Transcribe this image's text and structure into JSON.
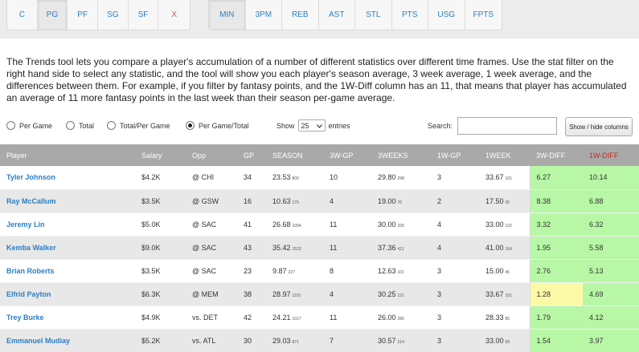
{
  "position_filters": [
    {
      "label": "C",
      "active": false
    },
    {
      "label": "PG",
      "active": true
    },
    {
      "label": "PF",
      "active": false
    },
    {
      "label": "SG",
      "active": false
    },
    {
      "label": "SF",
      "active": false
    },
    {
      "label": "X",
      "active": false
    }
  ],
  "stat_filters": [
    {
      "label": "MIN",
      "active": true
    },
    {
      "label": "3PM",
      "active": false
    },
    {
      "label": "REB",
      "active": false
    },
    {
      "label": "AST",
      "active": false
    },
    {
      "label": "STL",
      "active": false
    },
    {
      "label": "PTS",
      "active": false
    },
    {
      "label": "USG",
      "active": false
    },
    {
      "label": "FPTS",
      "active": false
    }
  ],
  "description": "The Trends tool lets you compare a player's accumulation of a number of different statistics over different time frames. Use the stat filter on the right hand side to select any statistic, and the tool will show you each player's season average, 3 week average, 1 week average, and the differences between them. For example, if you filter by fantasy points, and the 1W-Diff column has an 11, that means that player has accumulated an average of 11 more fantasy points in the last week than their season per-game average.",
  "view_options": [
    {
      "label": "Per Game",
      "checked": false
    },
    {
      "label": "Total",
      "checked": false
    },
    {
      "label": "Total/Per Game",
      "checked": false
    },
    {
      "label": "Per Game/Total",
      "checked": true
    }
  ],
  "length": {
    "show_label": "Show",
    "value": "25",
    "entries_label": "entries"
  },
  "search": {
    "label": "Search:",
    "value": ""
  },
  "show_hide_label": "Show / hide columns",
  "columns": [
    "Player",
    "Salary",
    "Opp",
    "GP",
    "SEASON",
    "3W-GP",
    "3WEEKS",
    "1W-GP",
    "1WEEK",
    "3W-DIFF",
    "1W-DIFF"
  ],
  "colors": {
    "diff_positive": "#b8f7a6",
    "diff_low": "#fbf9a8",
    "header_bg": "#a9a9a9",
    "link": "#2b7fc4",
    "negative_header": "#d9231a"
  },
  "rows": [
    {
      "player": "Tyler Johnson",
      "salary": "$4.2K",
      "opp": "@ CHI",
      "gp": "34",
      "season": "23.53",
      "season_sub": "800",
      "w3gp": "10",
      "w3": "29.80",
      "w3_sub": "298",
      "w1gp": "3",
      "w1": "33.67",
      "w1_sub": "101",
      "d3": "6.27",
      "d1": "10.14",
      "d3_low": false
    },
    {
      "player": "Ray McCallum",
      "salary": "$3.5K",
      "opp": "@ GSW",
      "gp": "16",
      "season": "10.63",
      "season_sub": "170",
      "w3gp": "4",
      "w3": "19.00",
      "w3_sub": "76",
      "w1gp": "2",
      "w1": "17.50",
      "w1_sub": "35",
      "d3": "8.38",
      "d1": "6.88",
      "d3_low": false
    },
    {
      "player": "Jeremy Lin",
      "salary": "$5.0K",
      "opp": "@ SAC",
      "gp": "41",
      "season": "26.68",
      "season_sub": "1094",
      "w3gp": "11",
      "w3": "30.00",
      "w3_sub": "330",
      "w1gp": "4",
      "w1": "33.00",
      "w1_sub": "132",
      "d3": "3.32",
      "d1": "6.32",
      "d3_low": false
    },
    {
      "player": "Kemba Walker",
      "salary": "$9.0K",
      "opp": "@ SAC",
      "gp": "43",
      "season": "35.42",
      "season_sub": "1523",
      "w3gp": "11",
      "w3": "37.36",
      "w3_sub": "411",
      "w1gp": "4",
      "w1": "41.00",
      "w1_sub": "164",
      "d3": "1.95",
      "d1": "5.58",
      "d3_low": false
    },
    {
      "player": "Brian Roberts",
      "salary": "$3.5K",
      "opp": "@ SAC",
      "gp": "23",
      "season": "9.87",
      "season_sub": "227",
      "w3gp": "8",
      "w3": "12.63",
      "w3_sub": "101",
      "w1gp": "3",
      "w1": "15.00",
      "w1_sub": "45",
      "d3": "2.76",
      "d1": "5.13",
      "d3_low": false
    },
    {
      "player": "Elfrid Payton",
      "salary": "$6.3K",
      "opp": "@ MEM",
      "gp": "38",
      "season": "28.97",
      "season_sub": "1101",
      "w3gp": "4",
      "w3": "30.25",
      "w3_sub": "121",
      "w1gp": "3",
      "w1": "33.67",
      "w1_sub": "101",
      "d3": "1.28",
      "d1": "4.69",
      "d3_low": true
    },
    {
      "player": "Trey Burke",
      "salary": "$4.9K",
      "opp": "vs. DET",
      "gp": "42",
      "season": "24.21",
      "season_sub": "1017",
      "w3gp": "11",
      "w3": "26.00",
      "w3_sub": "286",
      "w1gp": "3",
      "w1": "28.33",
      "w1_sub": "85",
      "d3": "1.79",
      "d1": "4.12",
      "d3_low": false
    },
    {
      "player": "Emmanuel Mudiay",
      "salary": "$5.2K",
      "opp": "vs. ATL",
      "gp": "30",
      "season": "29.03",
      "season_sub": "871",
      "w3gp": "7",
      "w3": "30.57",
      "w3_sub": "214",
      "w1gp": "3",
      "w1": "33.00",
      "w1_sub": "99",
      "d3": "1.54",
      "d1": "3.97",
      "d3_low": false
    }
  ]
}
